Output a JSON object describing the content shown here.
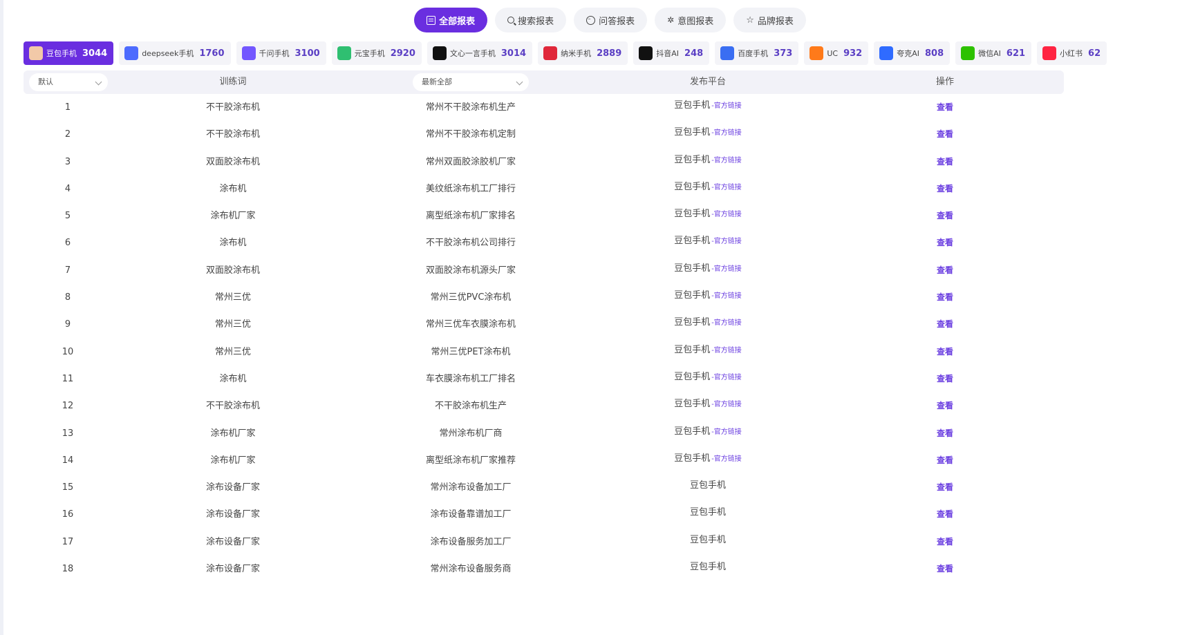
{
  "report_tabs": [
    {
      "label": "全部报表",
      "icon": "document-icon",
      "active": true
    },
    {
      "label": "搜索报表",
      "icon": "search-icon",
      "active": false
    },
    {
      "label": "问答报表",
      "icon": "chat-icon",
      "active": false
    },
    {
      "label": "意图报表",
      "icon": "sparkle-icon",
      "active": false
    },
    {
      "label": "品牌报表",
      "icon": "star-icon",
      "active": false
    }
  ],
  "platforms": [
    {
      "name": "豆包手机",
      "count": "3044",
      "logo": "doubao-logo",
      "color": "#f2c9a8",
      "active": true
    },
    {
      "name": "deepseek手机",
      "count": "1760",
      "logo": "deepseek-logo",
      "color": "#4d6bfe"
    },
    {
      "name": "千问手机",
      "count": "3100",
      "logo": "qianwen-logo",
      "color": "#7357ff"
    },
    {
      "name": "元宝手机",
      "count": "2920",
      "logo": "yuanbao-logo",
      "color": "#2fbf71"
    },
    {
      "name": "文心一言手机",
      "count": "3014",
      "logo": "wenxin-logo",
      "color": "#111111"
    },
    {
      "name": "纳米手机",
      "count": "2889",
      "logo": "nami-logo",
      "color": "#e0273a"
    },
    {
      "name": "抖音AI",
      "count": "248",
      "logo": "douyin-logo",
      "color": "#111111"
    },
    {
      "name": "百度手机",
      "count": "373",
      "logo": "baidu-logo",
      "color": "#3a6ef2"
    },
    {
      "name": "UC",
      "count": "932",
      "logo": "uc-logo",
      "color": "#ff7a1a"
    },
    {
      "name": "夸克AI",
      "count": "808",
      "logo": "quark-logo",
      "color": "#2f6bff"
    },
    {
      "name": "微信AI",
      "count": "621",
      "logo": "wechat-logo",
      "color": "#2dc100"
    },
    {
      "name": "小红书",
      "count": "62",
      "logo": "xiaohongshu-logo",
      "color": "#ff2442"
    }
  ],
  "table": {
    "sort_dropdown": "默认",
    "col_keyword": "训练词",
    "filter_dropdown": "最新全部",
    "col_platform": "发布平台",
    "col_action": "操作",
    "official_link": "-官方链接",
    "view_label": "查看",
    "rows": [
      {
        "idx": "1",
        "keyword": "不干胶涂布机",
        "query": "常州不干胶涂布机生产",
        "platform": "豆包手机",
        "link": true
      },
      {
        "idx": "2",
        "keyword": "不干胶涂布机",
        "query": "常州不干胶涂布机定制",
        "platform": "豆包手机",
        "link": true
      },
      {
        "idx": "3",
        "keyword": "双面胶涂布机",
        "query": "常州双面胶涂胶机厂家",
        "platform": "豆包手机",
        "link": true
      },
      {
        "idx": "4",
        "keyword": "涂布机",
        "query": "美纹纸涂布机工厂排行",
        "platform": "豆包手机",
        "link": true
      },
      {
        "idx": "5",
        "keyword": "涂布机厂家",
        "query": "离型纸涂布机厂家排名",
        "platform": "豆包手机",
        "link": true
      },
      {
        "idx": "6",
        "keyword": "涂布机",
        "query": "不干胶涂布机公司排行",
        "platform": "豆包手机",
        "link": true
      },
      {
        "idx": "7",
        "keyword": "双面胶涂布机",
        "query": "双面胶涂布机源头厂家",
        "platform": "豆包手机",
        "link": true
      },
      {
        "idx": "8",
        "keyword": "常州三优",
        "query": "常州三优PVC涂布机",
        "platform": "豆包手机",
        "link": true
      },
      {
        "idx": "9",
        "keyword": "常州三优",
        "query": "常州三优车衣膜涂布机",
        "platform": "豆包手机",
        "link": true
      },
      {
        "idx": "10",
        "keyword": "常州三优",
        "query": "常州三优PET涂布机",
        "platform": "豆包手机",
        "link": true
      },
      {
        "idx": "11",
        "keyword": "涂布机",
        "query": "车衣膜涂布机工厂排名",
        "platform": "豆包手机",
        "link": true
      },
      {
        "idx": "12",
        "keyword": "不干胶涂布机",
        "query": "不干胶涂布机生产",
        "platform": "豆包手机",
        "link": true
      },
      {
        "idx": "13",
        "keyword": "涂布机厂家",
        "query": "常州涂布机厂商",
        "platform": "豆包手机",
        "link": true
      },
      {
        "idx": "14",
        "keyword": "涂布机厂家",
        "query": "离型纸涂布机厂家推荐",
        "platform": "豆包手机",
        "link": true
      },
      {
        "idx": "15",
        "keyword": "涂布设备厂家",
        "query": "常州涂布设备加工厂",
        "platform": "豆包手机",
        "link": false
      },
      {
        "idx": "16",
        "keyword": "涂布设备厂家",
        "query": "涂布设备靠谱加工厂",
        "platform": "豆包手机",
        "link": false
      },
      {
        "idx": "17",
        "keyword": "涂布设备厂家",
        "query": "涂布设备服务加工厂",
        "platform": "豆包手机",
        "link": false
      },
      {
        "idx": "18",
        "keyword": "涂布设备厂家",
        "query": "常州涂布设备服务商",
        "platform": "豆包手机",
        "link": false
      }
    ]
  }
}
